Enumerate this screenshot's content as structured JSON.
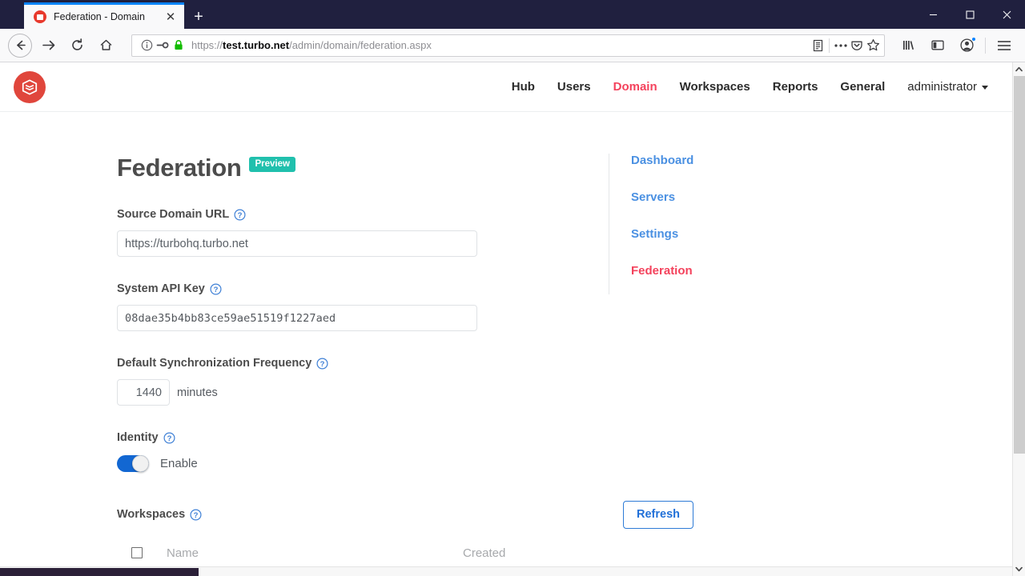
{
  "browser": {
    "tab": {
      "title": "Federation - Domain",
      "favicon": "turbo-logo-icon",
      "close_label": "✕"
    },
    "newtab_label": "+",
    "window_controls": {
      "minimize": "minimize-icon",
      "maximize": "maximize-icon",
      "close": "close-icon"
    },
    "nav": {
      "back": "back-arrow-icon",
      "forward": "forward-arrow-icon",
      "reload": "reload-icon",
      "home": "home-icon"
    },
    "urlbar": {
      "identity_icon": "info-circle-icon",
      "permission_icon": "key-icon",
      "lock_icon": "padlock-icon",
      "url_scheme": "https://",
      "url_host": "test.turbo.net",
      "url_path": "/admin/domain/federation.aspx",
      "reader_icon": "reader-view-icon",
      "more_icon": "page-actions-icon",
      "pocket_icon": "pocket-icon",
      "bookmark_icon": "star-icon"
    },
    "toolbar": {
      "library": "library-icon",
      "sidebar": "sidebar-icon",
      "account": "account-icon",
      "menu": "hamburger-menu-icon"
    }
  },
  "app": {
    "logo": "turbo-cube-logo",
    "nav_items": [
      {
        "label": "Hub",
        "active": false
      },
      {
        "label": "Users",
        "active": false
      },
      {
        "label": "Domain",
        "active": true
      },
      {
        "label": "Workspaces",
        "active": false
      },
      {
        "label": "Reports",
        "active": false
      },
      {
        "label": "General",
        "active": false
      }
    ],
    "user_menu": {
      "label": "administrator",
      "caret": "chevron-down-icon"
    }
  },
  "main": {
    "title": "Federation",
    "badge": "Preview",
    "help_icon": "question-circle-icon",
    "fields": {
      "source_domain_url": {
        "label": "Source Domain URL",
        "value": "https://turbohq.turbo.net"
      },
      "system_api_key": {
        "label": "System API Key",
        "value": "08dae35b4bb83ce59ae51519f1227aed"
      },
      "sync_frequency": {
        "label": "Default Synchronization Frequency",
        "value": "1440",
        "unit": "minutes"
      },
      "identity": {
        "label": "Identity",
        "toggle_label": "Enable",
        "toggle_on": true
      },
      "workspaces": {
        "label": "Workspaces",
        "refresh_label": "Refresh",
        "columns": [
          "Name",
          "Created"
        ],
        "rows": []
      }
    }
  },
  "sidebar": {
    "links": [
      {
        "label": "Dashboard",
        "active": false
      },
      {
        "label": "Servers",
        "active": false
      },
      {
        "label": "Settings",
        "active": false
      },
      {
        "label": "Federation",
        "active": true
      }
    ]
  },
  "colors": {
    "accent_red": "#f4425c",
    "brand_red": "#e0463c",
    "link_blue": "#4a90e2",
    "badge_teal": "#20c0ad",
    "toggle_blue": "#1267d2",
    "titlebar": "#20203f"
  }
}
